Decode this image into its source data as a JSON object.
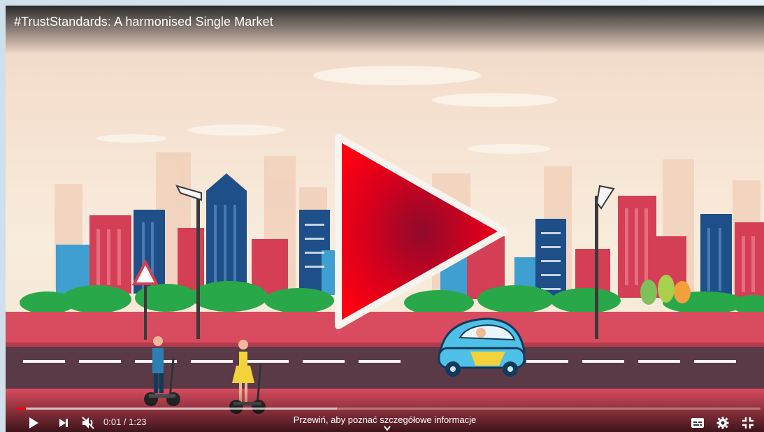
{
  "video": {
    "title": "#TrustStandards: A harmonised Single Market",
    "current_time": "0:01",
    "duration": "1:23",
    "time_display": "0:01 / 1:23",
    "progress_fraction": 0.012,
    "buffered_fraction": 0.43,
    "muted": true
  },
  "overlay": {
    "seek_hint": "Przewiń, aby poznać szczegółowe informacje",
    "play_button_color": "#e00014"
  },
  "controls": {
    "play_icon": "play-icon",
    "next_icon": "next-icon",
    "volume_icon": "volume-muted-icon",
    "captions_icon": "subtitles-icon",
    "settings_icon": "gear-icon",
    "fullscreen_icon": "exit-fullscreen-icon"
  },
  "colors": {
    "accent_red": "#ff0000",
    "road": "#5a3a46",
    "sidewalk": "#d94b5e"
  }
}
